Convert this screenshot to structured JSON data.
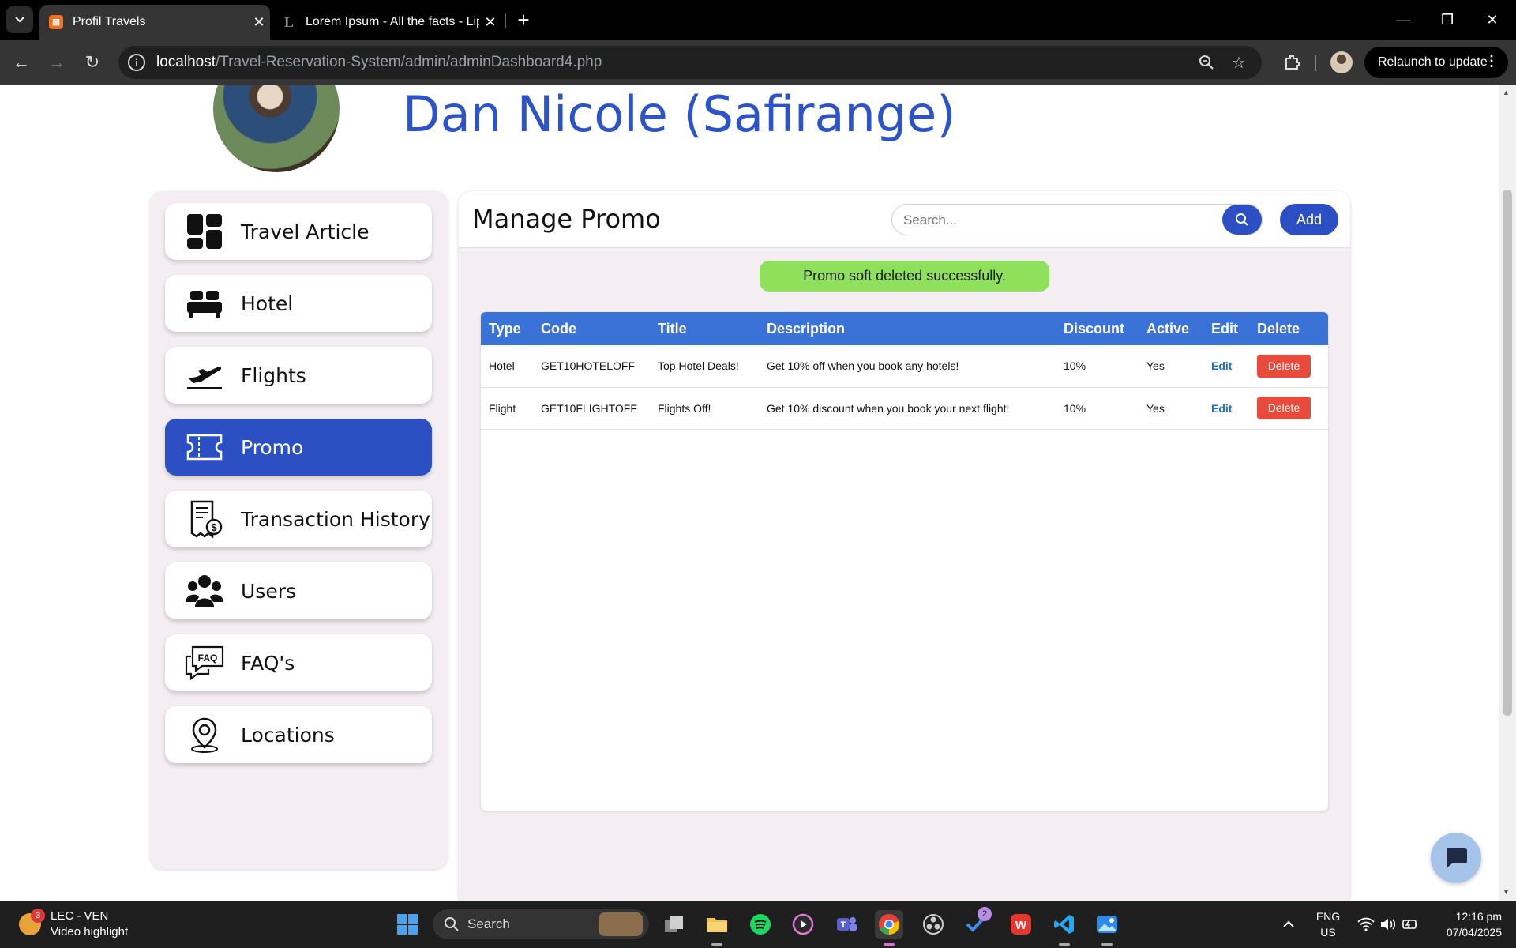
{
  "browser": {
    "tabs": [
      {
        "title": "Profil Travels",
        "active": true
      },
      {
        "title": "Lorem Ipsum - All the facts - Lip",
        "active": false
      }
    ],
    "url_host": "localhost",
    "url_path": "/Travel-Reservation-System/admin/adminDashboard4.php",
    "relaunch_label": "Relaunch to update"
  },
  "header": {
    "admin_name": "Dan Nicole (Safirange)"
  },
  "sidebar": {
    "items": [
      {
        "label": "Travel Article",
        "icon": "dashboard-grid-icon"
      },
      {
        "label": "Hotel",
        "icon": "bed-icon"
      },
      {
        "label": "Flights",
        "icon": "plane-takeoff-icon"
      },
      {
        "label": "Promo",
        "icon": "ticket-icon",
        "active": true
      },
      {
        "label": "Transaction History",
        "icon": "receipt-icon"
      },
      {
        "label": "Users",
        "icon": "users-icon"
      },
      {
        "label": "FAQ's",
        "icon": "faq-icon"
      },
      {
        "label": "Locations",
        "icon": "location-pin-icon"
      }
    ]
  },
  "main": {
    "title": "Manage Promo",
    "search_placeholder": "Search...",
    "add_label": "Add",
    "toast": "Promo soft deleted successfully.",
    "columns": [
      "Type",
      "Code",
      "Title",
      "Description",
      "Discount",
      "Active",
      "Edit",
      "Delete"
    ],
    "rows": [
      {
        "type": "Hotel",
        "code": "GET10HOTELOFF",
        "title": "Top Hotel Deals!",
        "description": "Get 10% off when you book any hotels!",
        "discount": "10%",
        "active": "Yes",
        "edit": "Edit",
        "delete": "Delete"
      },
      {
        "type": "Flight",
        "code": "GET10FLIGHTOFF",
        "title": "Flights Off!",
        "description": "Get 10% discount when you book your next flight!",
        "discount": "10%",
        "active": "Yes",
        "edit": "Edit",
        "delete": "Delete"
      }
    ]
  },
  "taskbar": {
    "weather_badge": "3",
    "weather_line1": "LEC - VEN",
    "weather_line2": "Video highlight",
    "search_label": "Search",
    "todo_badge": "2",
    "lang_line1": "ENG",
    "lang_line2": "US",
    "time": "12:16 pm",
    "date": "07/04/2025"
  },
  "colors": {
    "accent": "#2c4fc3",
    "name_blue": "#2c54c8",
    "table_header": "#3b72d8",
    "toast_green": "#8fe05a",
    "delete_red": "#e84b3c"
  }
}
